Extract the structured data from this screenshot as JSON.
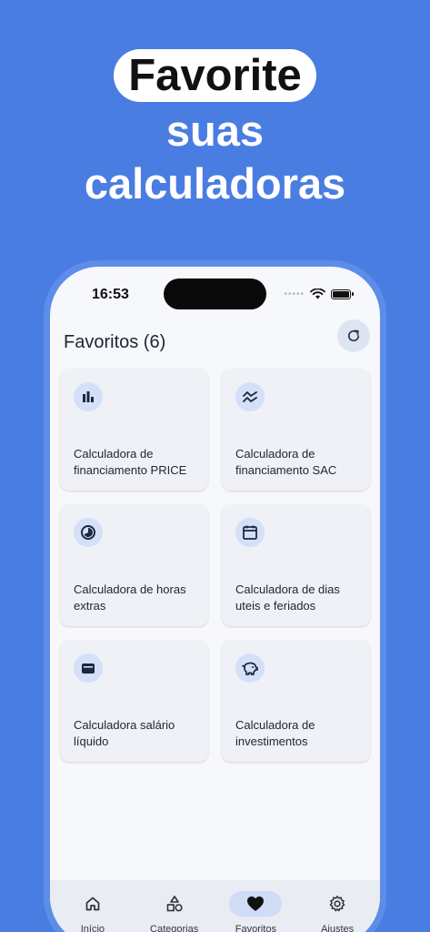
{
  "headline": {
    "highlight": "Favorite",
    "line2": "suas",
    "line3": "calculadoras"
  },
  "status_bar": {
    "time": "16:53",
    "signal_dots": "•••••"
  },
  "favorites": {
    "title": "Favoritos (6)",
    "refresh_icon": "refresh-icon",
    "cards": [
      {
        "icon": "bar-chart-icon",
        "label": "Calculadora de financiamento PRICE"
      },
      {
        "icon": "trend-lines-icon",
        "label": "Calculadora de financiamento SAC"
      },
      {
        "icon": "clock-icon",
        "label": "Calculadora de horas extras"
      },
      {
        "icon": "calendar-icon",
        "label": "Calculadora de dias uteis e feriados"
      },
      {
        "icon": "wallet-icon",
        "label": "Calculadora salário líquido"
      },
      {
        "icon": "piggy-bank-icon",
        "label": "Calculadora de investimentos"
      }
    ]
  },
  "bottom_nav": {
    "items": [
      {
        "label": "Início",
        "icon": "home-icon"
      },
      {
        "label": "Categorias",
        "icon": "shapes-icon"
      },
      {
        "label": "Favoritos",
        "icon": "heart-icon",
        "active": true
      },
      {
        "label": "Ajustes",
        "icon": "gear-icon"
      }
    ]
  },
  "colors": {
    "background": "#4a7de2",
    "accent_chip": "#d3e0f8",
    "card": "#eff1f7"
  }
}
